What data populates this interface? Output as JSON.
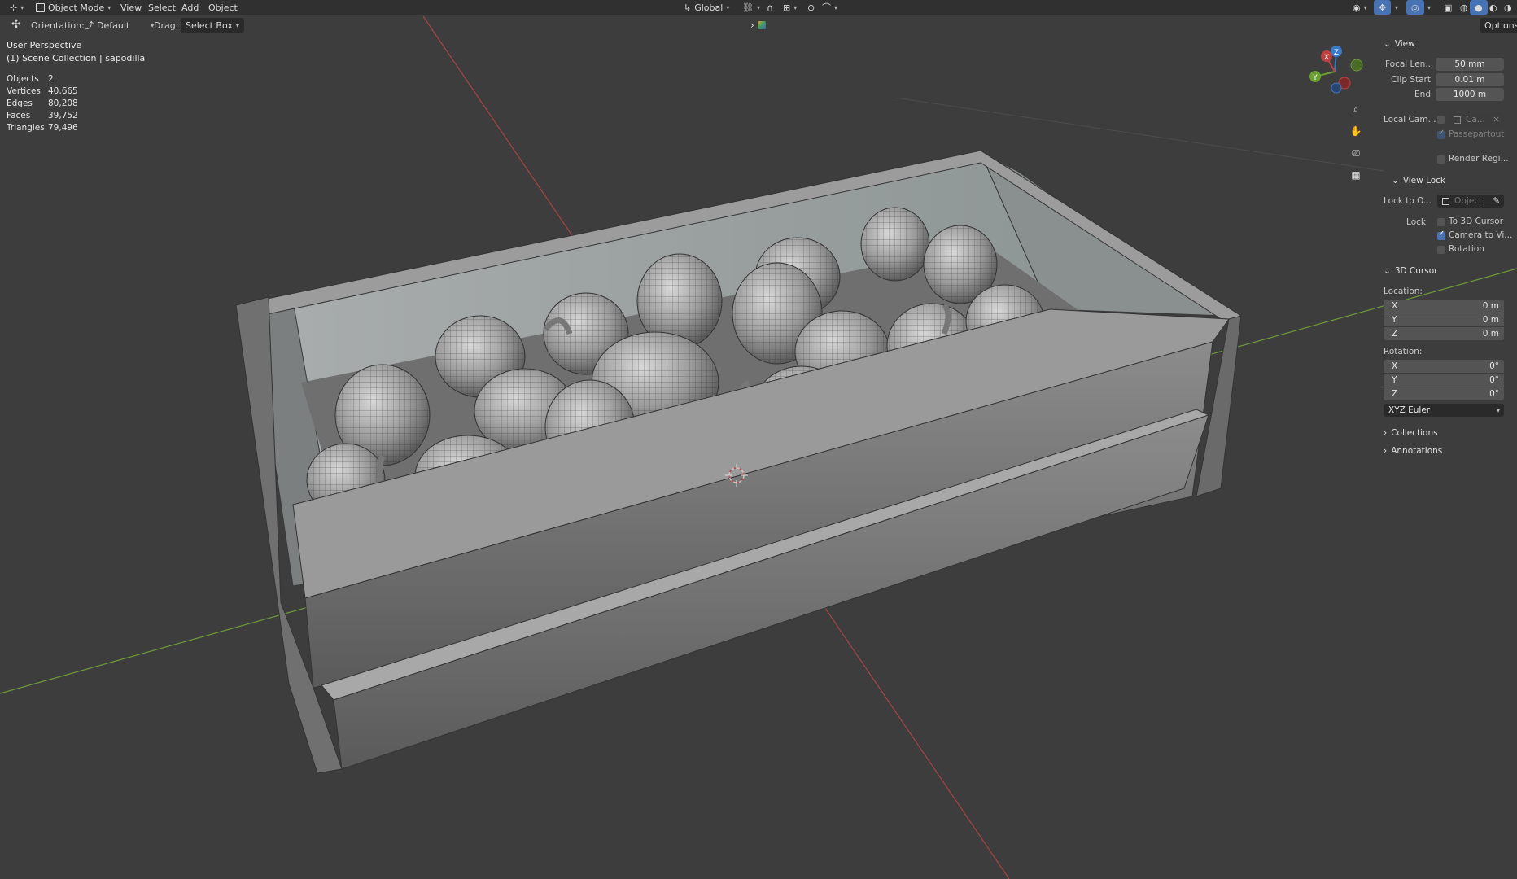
{
  "header": {
    "mode": "Object Mode",
    "menus": [
      "View",
      "Select",
      "Add",
      "Object"
    ],
    "transform_orientation": "Global",
    "options_label": "Options"
  },
  "toolbar": {
    "orientation_label": "Orientation:",
    "orientation_value": "Default",
    "drag_label": "Drag:",
    "drag_value": "Select Box"
  },
  "overlay": {
    "view_name": "User Perspective",
    "collection": "(1) Scene Collection | sapodilla",
    "stats": [
      {
        "label": "Objects",
        "value": "2"
      },
      {
        "label": "Vertices",
        "value": "40,665"
      },
      {
        "label": "Edges",
        "value": "80,208"
      },
      {
        "label": "Faces",
        "value": "39,752"
      },
      {
        "label": "Triangles",
        "value": "79,496"
      }
    ]
  },
  "gizmo": {
    "x": "X",
    "y": "Y",
    "z": "Z"
  },
  "panel": {
    "view": {
      "title": "View",
      "focal_label": "Focal Len...",
      "focal_value": "50 mm",
      "clip_start_label": "Clip Start",
      "clip_start_value": "0.01 m",
      "end_label": "End",
      "end_value": "1000 m",
      "local_cam_label": "Local Cam...",
      "local_cam_value": "Ca...",
      "passepartout": "Passepartout",
      "render_region": "Render Regi..."
    },
    "view_lock": {
      "title": "View Lock",
      "lock_to_label": "Lock to O...",
      "lock_to_value": "Object",
      "lock_label": "Lock",
      "to_3d_cursor": "To 3D Cursor",
      "camera_to_view": "Camera to Vi...",
      "rotation": "Rotation"
    },
    "cursor": {
      "title": "3D Cursor",
      "location_label": "Location:",
      "loc": [
        {
          "axis": "X",
          "value": "0 m"
        },
        {
          "axis": "Y",
          "value": "0 m"
        },
        {
          "axis": "Z",
          "value": "0 m"
        }
      ],
      "rotation_label": "Rotation:",
      "rot": [
        {
          "axis": "X",
          "value": "0°"
        },
        {
          "axis": "Y",
          "value": "0°"
        },
        {
          "axis": "Z",
          "value": "0°"
        }
      ],
      "rotation_mode": "XYZ Euler"
    },
    "collections": "Collections",
    "annotations": "Annotations"
  },
  "colors": {
    "background": "#3d3d3d",
    "x_axis": "#b04545",
    "y_axis": "#6e9a3a",
    "accent": "#4772b3"
  }
}
